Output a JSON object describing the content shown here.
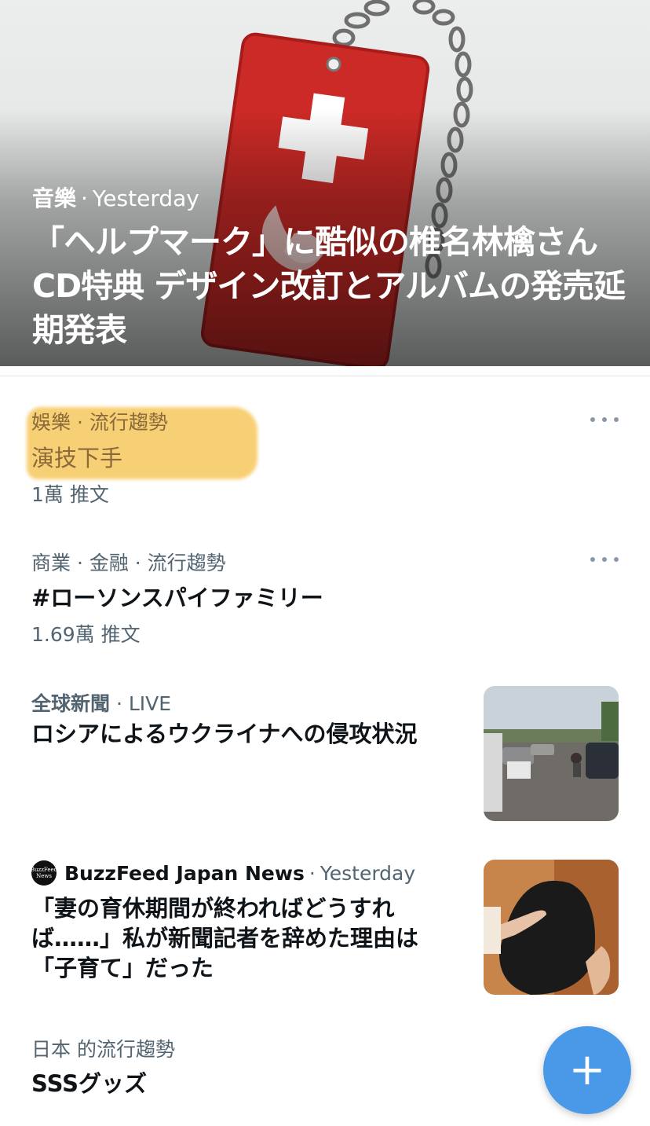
{
  "hero": {
    "category": "音樂",
    "time": "Yesterday",
    "title": "「ヘルプマーク」に酷似の椎名林檎さんCD特典 デザイン改訂とアルバムの発売延期発表"
  },
  "trends": [
    {
      "meta": "娛樂 · 流行趨勢",
      "title": "演技下手",
      "count": "1萬 推文",
      "highlight_color": "#f6c24e"
    },
    {
      "meta": "商業 · 金融 · 流行趨勢",
      "title": "#ローソンスパイファミリー",
      "count": "1.69萬 推文"
    }
  ],
  "news": [
    {
      "category": "全球新聞",
      "status": "LIVE",
      "title": "ロシアによるウクライナへの侵攻状況",
      "thumb_icon": "street-photo"
    },
    {
      "source": "BuzzFeed Japan News",
      "source_logo_text": "BuzzFeed News",
      "time": "Yesterday",
      "title": "「妻の育休期間が終わればどうすれば……」私が新聞記者を辞めた理由は「子育て」だった",
      "thumb_icon": "family-photo"
    }
  ],
  "last_trend": {
    "meta": "日本 的流行趨勢",
    "title": "SSSグッズ"
  },
  "fab": {
    "icon": "+",
    "color": "#4a99e9"
  },
  "colors": {
    "secondary_text": "#536471",
    "primary_text": "#0f1419",
    "accent": "#1d9bf0"
  }
}
